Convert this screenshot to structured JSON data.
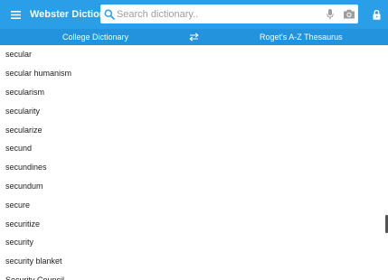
{
  "app": {
    "title": "Webster Dictionary"
  },
  "search": {
    "placeholder": "Search dictionary.."
  },
  "icons": {
    "menu": "hamburger-menu-icon",
    "search": "magnifier-icon",
    "mic": "microphone-icon",
    "camera": "camera-icon",
    "lock": "lock-icon",
    "swap": "swap-arrows-icon"
  },
  "colors": {
    "toolbar": "#2a9ee6",
    "tabbar": "#2293dc"
  },
  "tabs": {
    "left": "College Dictionary",
    "right": "Roget's A-Z Thesaurus"
  },
  "words": [
    "secular",
    "secular humanism",
    "secularism",
    "secularity",
    "secularize",
    "secund",
    "secundines",
    "secundum",
    "secure",
    "securitize",
    "security",
    "security blanket",
    "Security Council"
  ]
}
